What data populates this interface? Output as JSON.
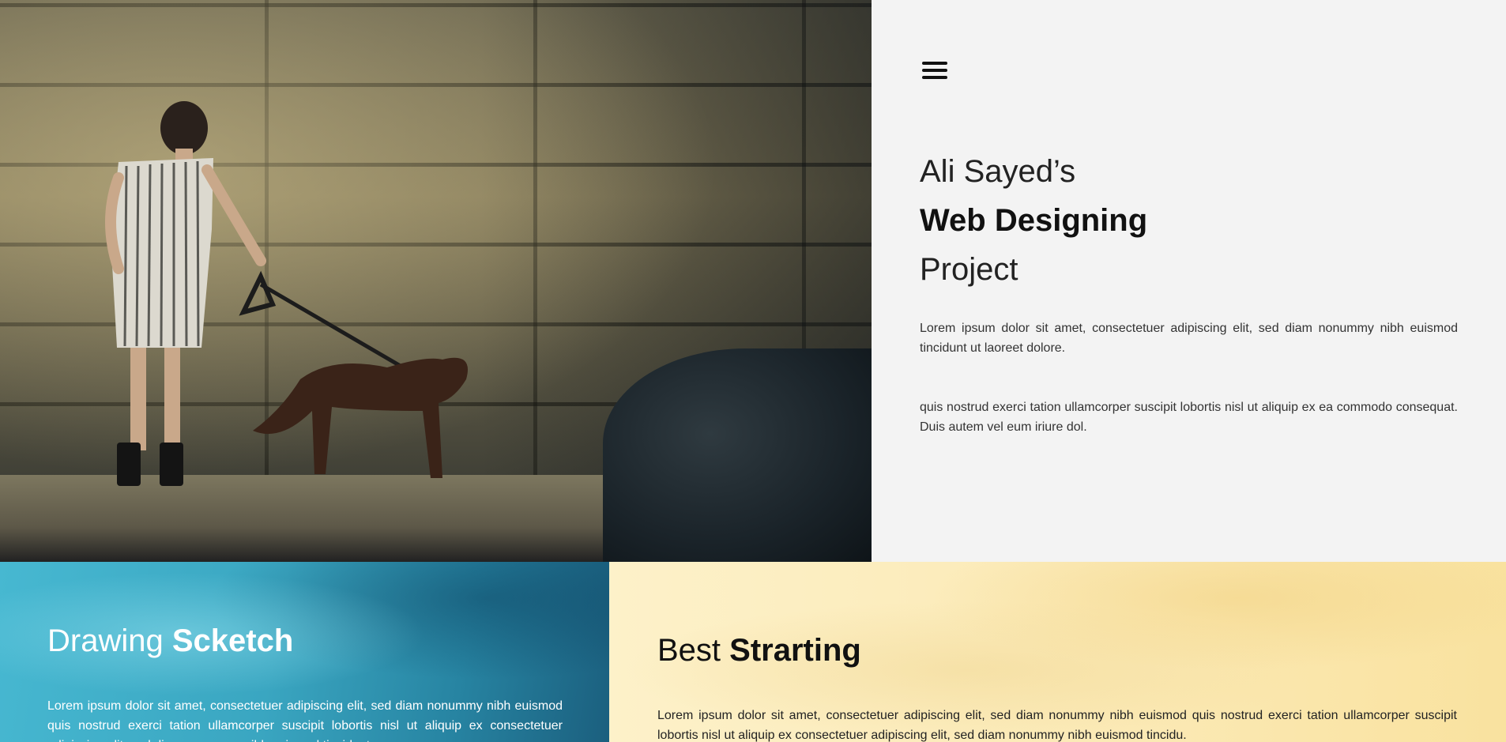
{
  "hero": {
    "image_alt": "Woman walking a dog in front of a stone wall"
  },
  "intro": {
    "menu_icon": "hamburger-menu-icon",
    "title_line1": "Ali Sayed’s",
    "title_line2": "Web Designing",
    "title_line3": "Project",
    "paragraph1": "Lorem ipsum dolor sit amet, consectetuer adipiscing elit, sed diam nonummy nibh euismod tincidunt ut laoreet dolore.",
    "paragraph2": "quis nostrud exerci tation ullamcorper suscipit lobortis nisl ut aliquip ex ea commodo consequat. Duis autem vel eum iriure dol."
  },
  "card_sketch": {
    "title_light": "Drawing ",
    "title_bold": "Scketch",
    "text": "Lorem ipsum dolor sit amet, consectetuer adipiscing elit, sed diam nonummy nibh euismod quis nostrud exerci tation ullamcorper suscipit lobortis nisl ut aliquip ex consectetuer adipiscing elit, sed diam nonummy nibh euismod tincidunt.",
    "bg_color": "#3aa6c1"
  },
  "card_start": {
    "title_light": "Best ",
    "title_bold": "Strarting",
    "text": "Lorem ipsum dolor sit amet, consectetuer adipiscing elit, sed diam nonummy nibh euismod quis nostrud exerci tation ullamcorper suscipit lobortis nisl ut aliquip ex consectetuer adipiscing elit, sed diam nonummy nibh euismod tincidu.",
    "bg_color": "#fbe9b4"
  }
}
